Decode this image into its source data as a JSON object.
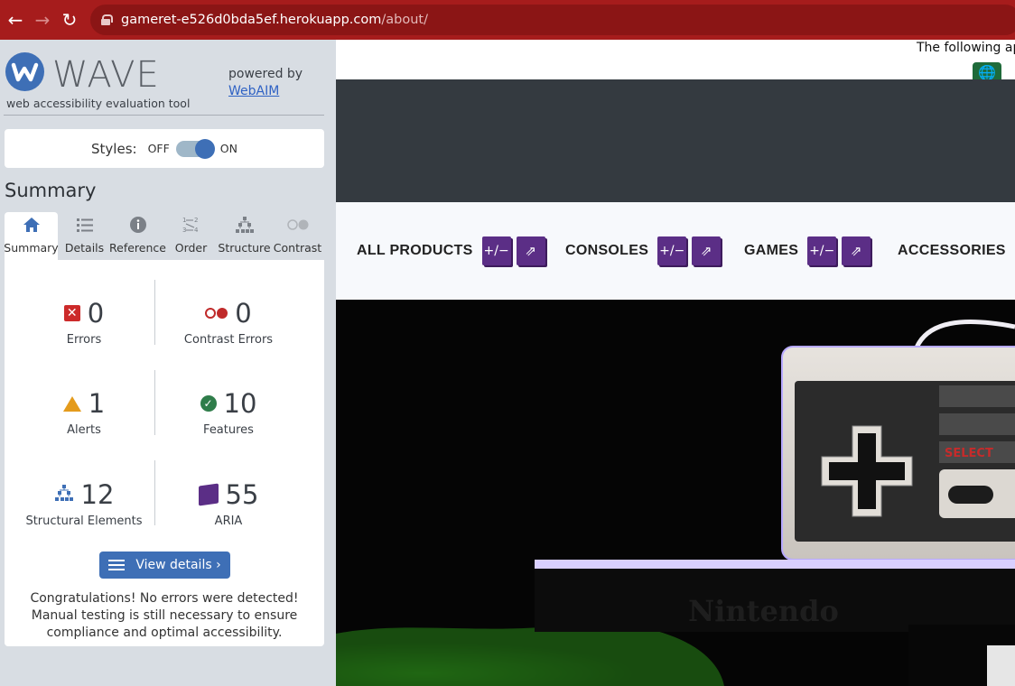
{
  "browser": {
    "url_host": "gameret-e526d0bda5ef.herokuapp.com",
    "url_path": "/about/"
  },
  "wave": {
    "logo_text": "WAVE",
    "tagline": "web accessibility evaluation tool",
    "powered_by": "powered by",
    "webaim_link": "WebAIM",
    "styles_label": "Styles:",
    "styles_off": "OFF",
    "styles_on": "ON",
    "summary_title": "Summary",
    "tabs": [
      {
        "label": "Summary",
        "icon": "home-icon",
        "active": true
      },
      {
        "label": "Details",
        "icon": "list-icon",
        "active": false
      },
      {
        "label": "Reference",
        "icon": "info-icon",
        "active": false
      },
      {
        "label": "Order",
        "icon": "order-icon",
        "active": false
      },
      {
        "label": "Structure",
        "icon": "structure-icon",
        "active": false
      },
      {
        "label": "Contrast",
        "icon": "contrast-icon",
        "active": false
      }
    ],
    "stats": {
      "errors": {
        "count": "0",
        "label": "Errors"
      },
      "contrast_errors": {
        "count": "0",
        "label": "Contrast Errors"
      },
      "alerts": {
        "count": "1",
        "label": "Alerts"
      },
      "features": {
        "count": "10",
        "label": "Features"
      },
      "structural": {
        "count": "12",
        "label": "Structural Elements"
      },
      "aria": {
        "count": "55",
        "label": "ARIA"
      }
    },
    "view_details": "View details ›",
    "congrats": "Congratulations! No errors were detected! Manual testing is still necessary to ensure compliance and optimal accessibility."
  },
  "site": {
    "notice": "The following app",
    "nav": [
      {
        "label": "ALL PRODUCTS"
      },
      {
        "label": "CONSOLES"
      },
      {
        "label": "GAMES"
      },
      {
        "label": "ACCESSORIES"
      }
    ],
    "badge_text": "+/−"
  },
  "colors": {
    "chrome": "#a61c1c",
    "wave_blue": "#3e6fb6",
    "aria_purple": "#5b2e86",
    "error_red": "#cc2a2a",
    "feature_green": "#2f7d4a",
    "alert_orange": "#e49b1c"
  }
}
